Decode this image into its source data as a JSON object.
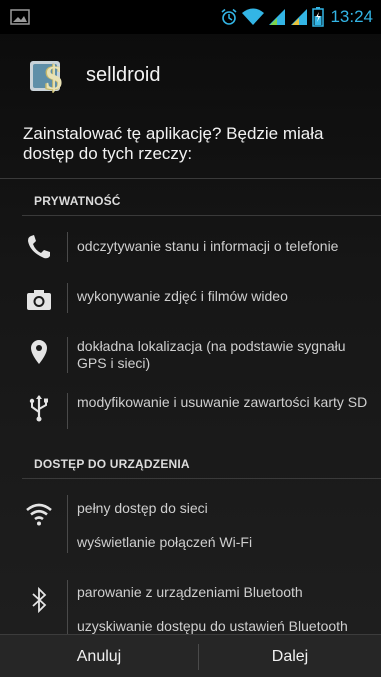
{
  "status_bar": {
    "time": "13:24",
    "icons": [
      "notification-icon",
      "alarm-icon",
      "wifi-icon",
      "signal-icon",
      "signal-icon",
      "battery-icon"
    ],
    "accent_color": "#33b5e5"
  },
  "app": {
    "name": "selldroid",
    "icon": "app-icon"
  },
  "prompt": "Zainstalować tę aplikację? Będzie miała dostęp do tych rzeczy:",
  "sections": [
    {
      "title": "PRYWATNOŚĆ",
      "permissions": [
        {
          "icon": "phone-icon",
          "lines": [
            "odczytywanie stanu i informacji o telefonie"
          ]
        },
        {
          "icon": "camera-icon",
          "lines": [
            "wykonywanie zdjęć i filmów wideo"
          ]
        },
        {
          "icon": "location-icon",
          "lines": [
            "dokładna lokalizacja (na podstawie sygnału GPS i sieci)"
          ]
        },
        {
          "icon": "usb-icon",
          "lines": [
            "modyfikowanie i usuwanie zawartości karty SD"
          ]
        }
      ]
    },
    {
      "title": "DOSTĘP DO URZĄDZENIA",
      "permissions": [
        {
          "icon": "wifi-icon",
          "lines": [
            "pełny dostęp do sieci",
            "wyświetlanie połączeń Wi-Fi"
          ]
        },
        {
          "icon": "bluetooth-icon",
          "lines": [
            "parowanie z urządzeniami Bluetooth",
            "uzyskiwanie dostępu do ustawień Bluetooth"
          ]
        }
      ]
    }
  ],
  "buttons": {
    "cancel": "Anuluj",
    "next": "Dalej"
  }
}
